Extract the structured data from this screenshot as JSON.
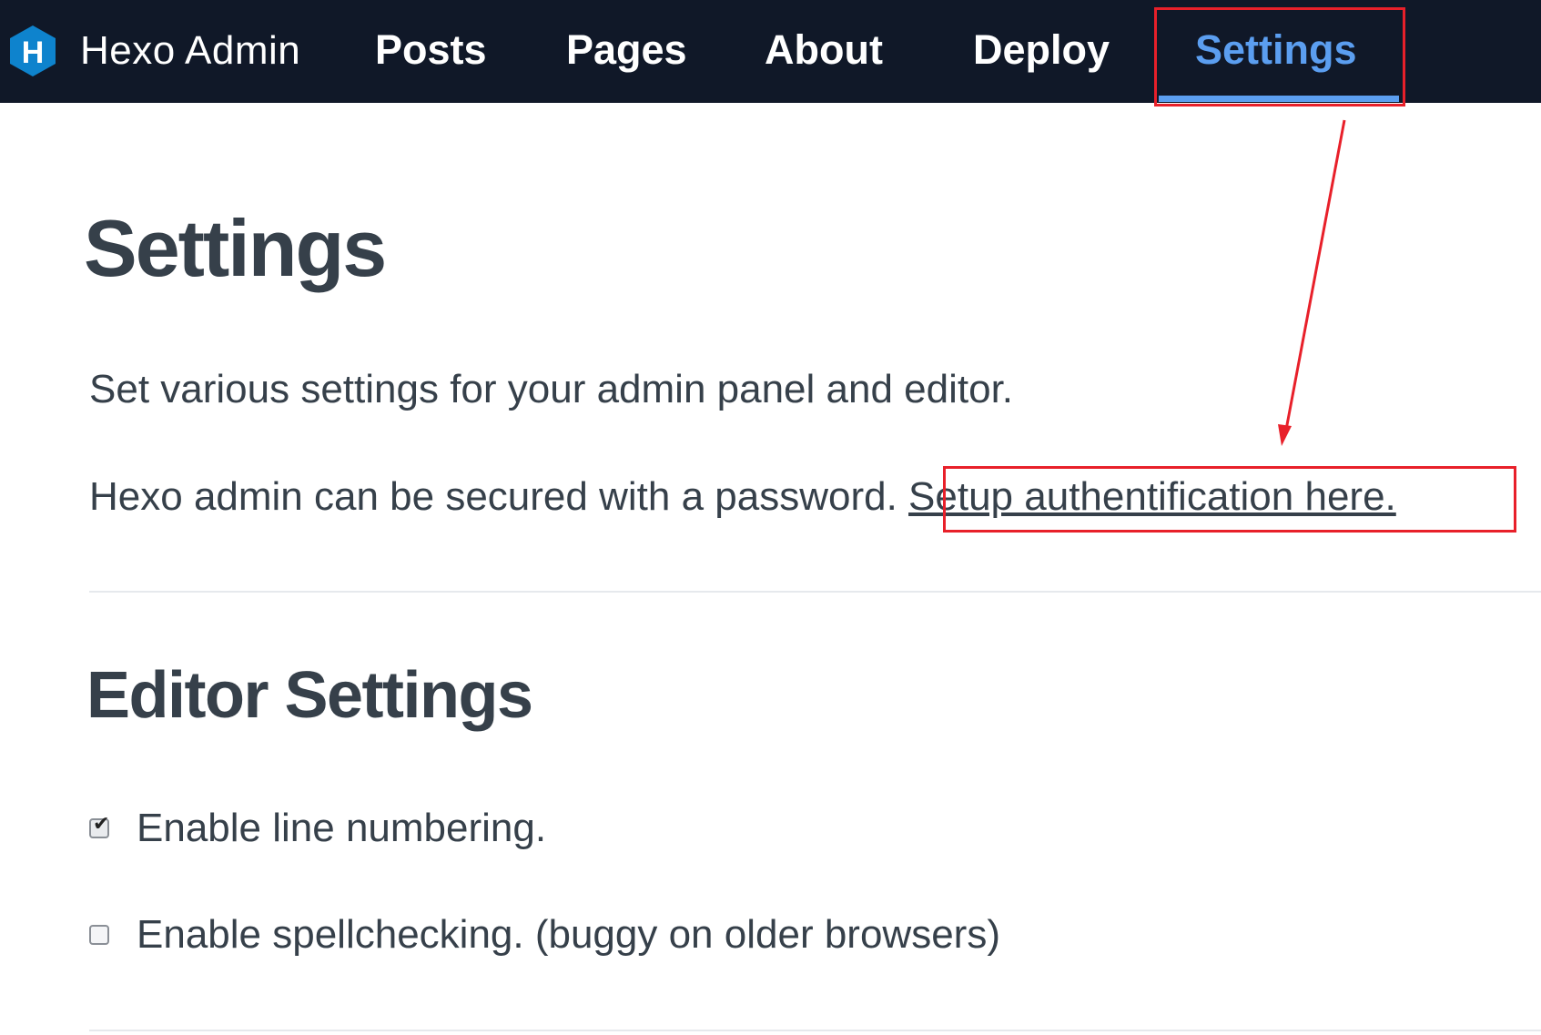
{
  "navbar": {
    "brand": {
      "logo_icon": "hexo-hexagon-logo-icon",
      "logo_letter": "H",
      "title": "Hexo Admin"
    },
    "items": [
      {
        "label": "Posts",
        "active": false
      },
      {
        "label": "Pages",
        "active": false
      },
      {
        "label": "About",
        "active": false
      },
      {
        "label": "Deploy",
        "active": false
      },
      {
        "label": "Settings",
        "active": true
      }
    ]
  },
  "main": {
    "title": "Settings",
    "description": "Set various settings for your admin panel and editor.",
    "auth_text": "Hexo admin can be secured with a password.",
    "auth_link": "Setup authentification here.",
    "editor_section": {
      "title": "Editor Settings",
      "options": [
        {
          "label": "Enable line numbering.",
          "checked": true
        },
        {
          "label": "Enable spellchecking. (buggy on older browsers)",
          "checked": false
        }
      ]
    }
  },
  "colors": {
    "navbar_bg": "#101828",
    "nav_active": "#5b9ef0",
    "text": "#36404a",
    "annotation": "#e8202a"
  }
}
